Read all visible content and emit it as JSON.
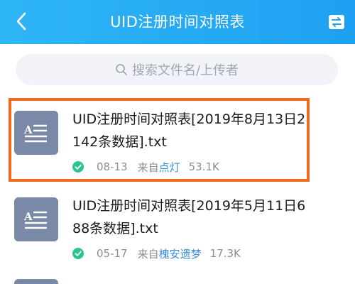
{
  "header": {
    "title": "UID注册时间对照表",
    "back_icon": "chevron-left-icon",
    "sort_icon": "swap-arrows-icon",
    "color": "#24a8f4"
  },
  "search": {
    "placeholder": "搜索文件名/上传者",
    "icon": "search-icon"
  },
  "files": [
    {
      "name": "UID注册时间对照表[2019年8月13日2142条数据].txt",
      "date": "08-13",
      "from_label": "来自",
      "uploader": "点灯",
      "size": "53.1K",
      "highlighted": true
    },
    {
      "name": "UID注册时间对照表[2019年5月11日688条数据].txt",
      "date": "05-17",
      "from_label": "来自",
      "uploader": "槐安遗梦",
      "size": "17.3K",
      "highlighted": false
    }
  ],
  "colors": {
    "highlight": "#f26a1e",
    "check": "#2bc48a",
    "uploader_link": "#3a90d6",
    "file_icon_bg": "#7b89a9"
  }
}
